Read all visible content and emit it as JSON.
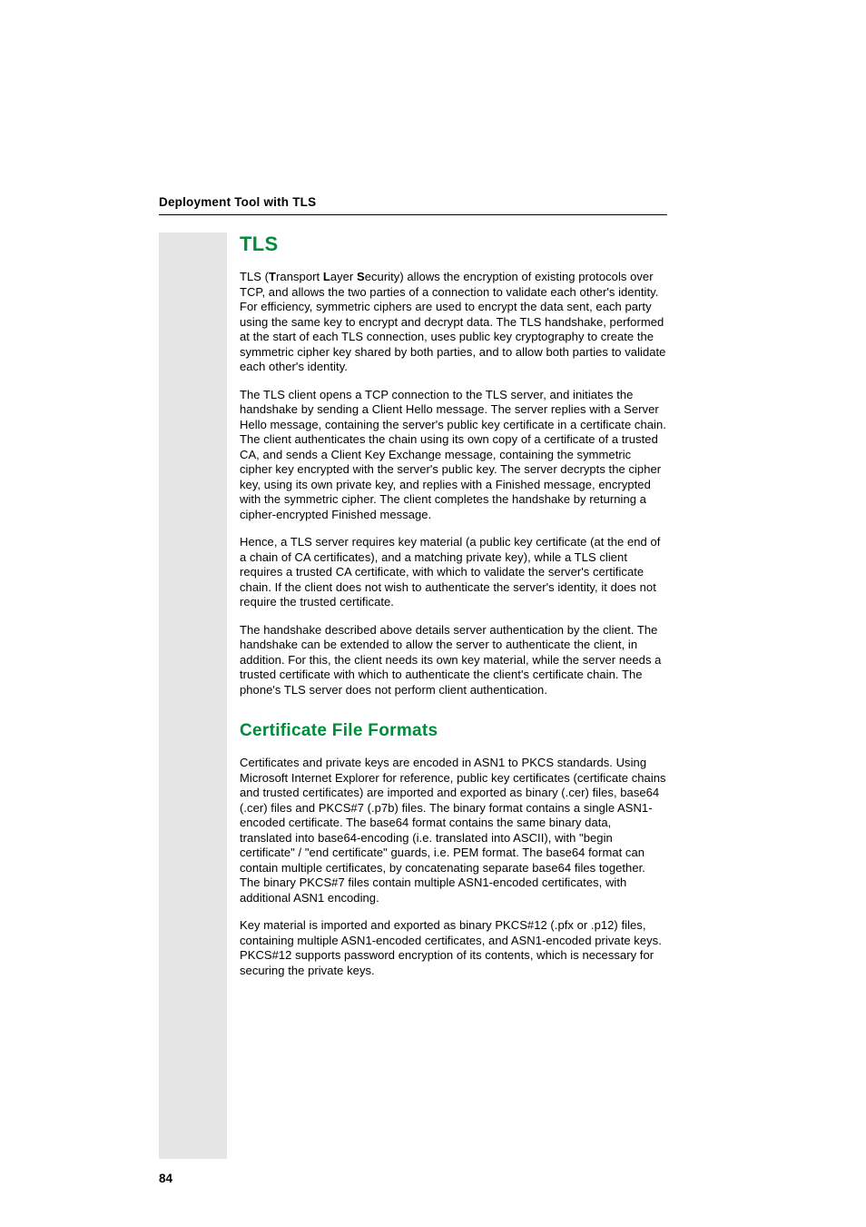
{
  "header": {
    "title": "Deployment Tool with TLS"
  },
  "section1": {
    "heading": "TLS",
    "p1_prefix": "TLS (",
    "p1_b1": "T",
    "p1_t1": "ransport ",
    "p1_b2": "L",
    "p1_t2": "ayer ",
    "p1_b3": "S",
    "p1_t3": "ecurity) allows the encryption of existing protocols over TCP, and allows the two parties of a connection to validate each other's identity. For efficiency, symmetric ciphers are used to encrypt the data sent, each party using the same key to encrypt and decrypt data. The TLS handshake, performed at the start of each TLS connection, uses public key cryptography to create the symmetric cipher key shared by both parties, and to allow both parties to validate each other's identity.",
    "p2": "The TLS client opens a TCP connection to the TLS server, and initiates the handshake by sending a Client Hello message. The server replies with a Server Hello message, containing the server's public key certificate in a certificate chain. The client authenticates the chain using its own copy of a certificate of a trusted CA, and sends a Client Key Exchange message, containing the symmetric cipher key encrypted with the server's public key. The server decrypts the cipher key, using its own private key, and replies with a Finished message, encrypted with the symmetric cipher. The client completes the handshake by returning a cipher-encrypted Finished message.",
    "p3": "Hence, a TLS server requires key material (a public key certificate (at the end of a chain of CA certificates), and a matching private key), while a TLS client requires a trusted CA certificate, with which to validate the server's certificate chain. If the client does not wish to authenticate the server's identity, it does not require the trusted certificate.",
    "p4": "The handshake described above details server authentication by the client. The handshake can be extended to allow the server to authenticate the client, in addition. For this, the client needs its own key material, while the server needs a trusted certificate with which to authenticate the client's certificate chain. The phone's TLS server does not perform client authentication."
  },
  "section2": {
    "heading": "Certificate File Formats",
    "p1": "Certificates and private keys are encoded in ASN1 to PKCS standards. Using Microsoft Internet Explorer for reference, public key certificates (certificate chains and trusted certificates) are imported and exported as binary (.cer) files, base64 (.cer) files and PKCS#7 (.p7b) files. The binary format contains a single ASN1-encoded certificate. The base64 format contains the same binary data, translated into base64-encoding (i.e. translated into ASCII), with \"begin certificate\" / \"end certificate\" guards, i.e. PEM format. The base64 format can contain multiple certificates, by concatenating separate base64 files together. The binary PKCS#7 files contain multiple ASN1-encoded certificates, with additional ASN1 encoding.",
    "p2": "Key material is imported and exported as binary PKCS#12 (.pfx or .p12) files, containing multiple ASN1-encoded certificates, and ASN1-encoded private keys. PKCS#12 supports password encryption of its contents, which is necessary for securing the private keys."
  },
  "pageNumber": "84"
}
